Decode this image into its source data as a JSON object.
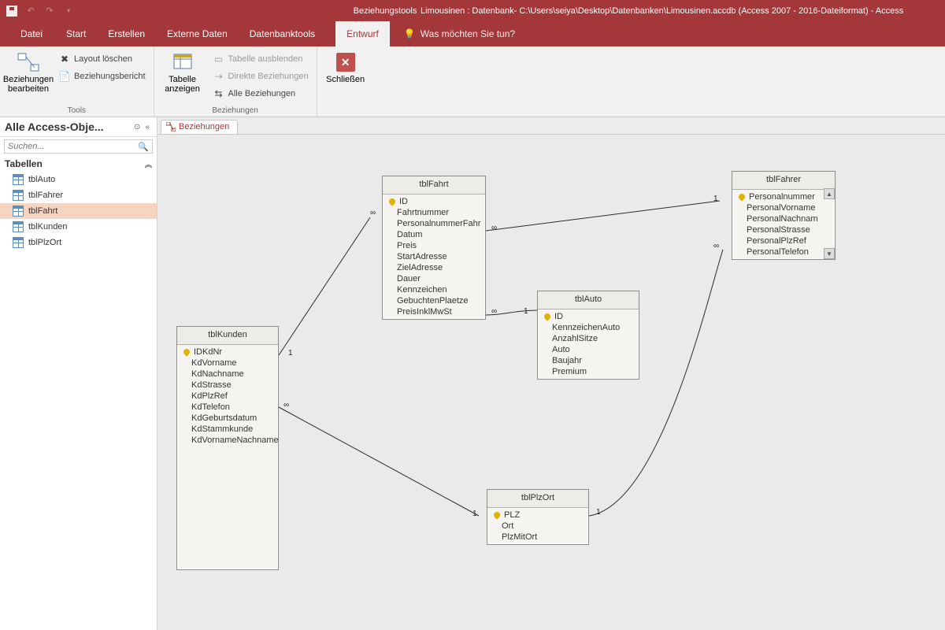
{
  "titlebar": {
    "context_tab_title": "Beziehungstools",
    "title": "Limousinen : Datenbank- C:\\Users\\seiya\\Desktop\\Datenbanken\\Limousinen.accdb (Access 2007 - 2016-Dateiformat)  -  Access"
  },
  "tabs": {
    "file": "Datei",
    "items": [
      "Start",
      "Erstellen",
      "Externe Daten",
      "Datenbanktools"
    ],
    "context": "Entwurf",
    "tellme": "Was möchten Sie tun?"
  },
  "ribbon": {
    "edit_rel": "Beziehungen\nbearbeiten",
    "clear_layout": "Layout löschen",
    "rel_report": "Beziehungsbericht",
    "group_tools": "Tools",
    "show_table": "Tabelle\nanzeigen",
    "hide_table": "Tabelle ausblenden",
    "direct_rel": "Direkte Beziehungen",
    "all_rel": "Alle Beziehungen",
    "group_rel": "Beziehungen",
    "close": "Schließen"
  },
  "nav": {
    "title": "Alle Access-Obje...",
    "search_ph": "Suchen...",
    "group": "Tabellen",
    "items": [
      "tblAuto",
      "tblFahrer",
      "tblFahrt",
      "tblKunden",
      "tblPlzOrt"
    ],
    "selected": "tblFahrt"
  },
  "doc_tab": "Beziehungen",
  "tables": {
    "tblFahrt": {
      "title": "tblFahrt",
      "fields": [
        "ID",
        "Fahrtnummer",
        "PersonalnummerFahr",
        "Datum",
        "Preis",
        "StartAdresse",
        "ZielAdresse",
        "Dauer",
        "Kennzeichen",
        "GebuchtenPlaetze",
        "PreisInklMwSt"
      ],
      "pk": [
        "ID"
      ]
    },
    "tblFahrer": {
      "title": "tblFahrer",
      "fields": [
        "Personalnummer",
        "PersonalVorname",
        "PersonalNachnam",
        "PersonalStrasse",
        "PersonalPlzRef",
        "PersonalTelefon"
      ],
      "pk": [
        "Personalnummer"
      ],
      "scroll": true
    },
    "tblAuto": {
      "title": "tblAuto",
      "fields": [
        "ID",
        "KennzeichenAuto",
        "AnzahlSitze",
        "Auto",
        "Baujahr",
        "Premium"
      ],
      "pk": [
        "ID"
      ]
    },
    "tblKunden": {
      "title": "tblKunden",
      "fields": [
        "IDKdNr",
        "KdVorname",
        "KdNachname",
        "KdStrasse",
        "KdPlzRef",
        "KdTelefon",
        "KdGeburtsdatum",
        "KdStammkunde",
        "KdVornameNachname"
      ],
      "pk": [
        "IDKdNr"
      ]
    },
    "tblPlzOrt": {
      "title": "tblPlzOrt",
      "fields": [
        "PLZ",
        "Ort",
        "PlzMitOrt"
      ],
      "pk": [
        "PLZ"
      ]
    }
  },
  "rel_labels": {
    "one": "1",
    "many": "∞"
  }
}
